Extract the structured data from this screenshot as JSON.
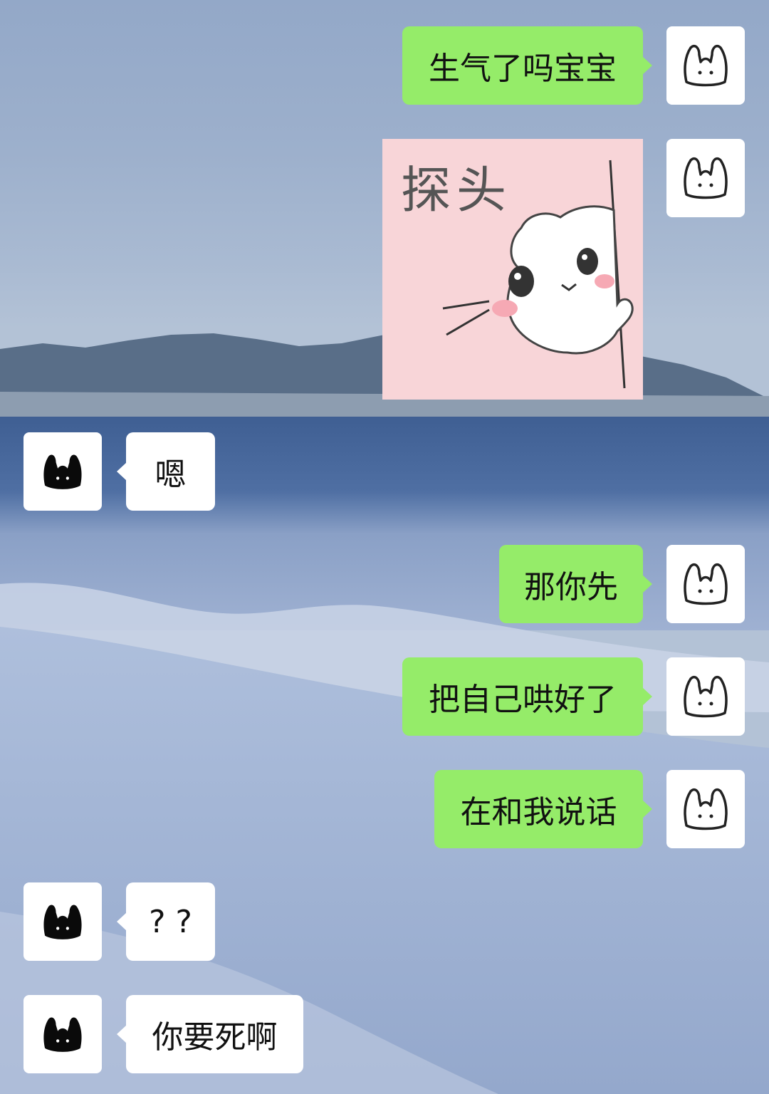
{
  "colors": {
    "outgoing_bubble": "#95ec69",
    "incoming_bubble": "#ffffff",
    "sticker_bg": "#f8d5d8"
  },
  "avatars": {
    "self": "white-bunny-outline-icon",
    "other": "black-bunny-icon"
  },
  "messages": [
    {
      "side": "out",
      "type": "text",
      "text": "生气了吗宝宝"
    },
    {
      "side": "out",
      "type": "sticker",
      "text": "探头",
      "icon": "peeking-cat-sticker"
    },
    {
      "side": "in",
      "type": "text",
      "text": "嗯"
    },
    {
      "side": "out",
      "type": "text",
      "text": "那你先"
    },
    {
      "side": "out",
      "type": "text",
      "text": "把自己哄好了"
    },
    {
      "side": "out",
      "type": "text",
      "text": "在和我说话"
    },
    {
      "side": "in",
      "type": "text",
      "text": "? ?"
    },
    {
      "side": "in",
      "type": "text",
      "text": "你要死啊"
    }
  ]
}
